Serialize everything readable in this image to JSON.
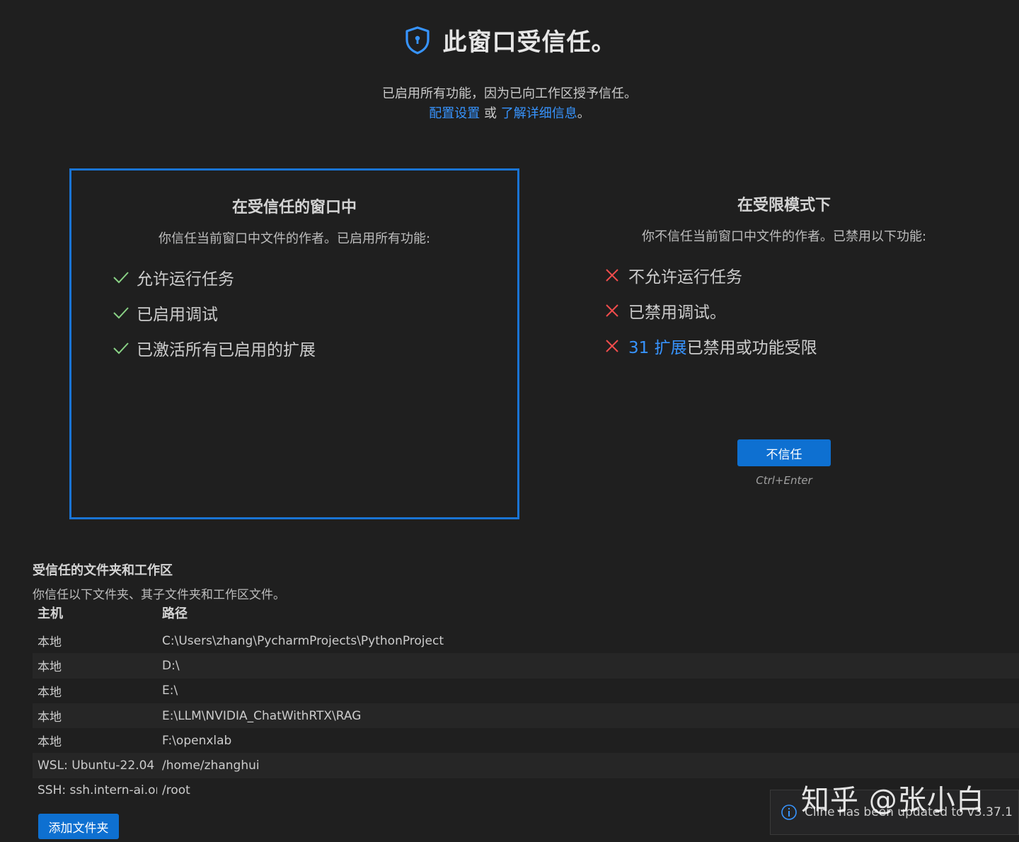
{
  "header": {
    "title": "此窗口受信任。",
    "subtitle": "已启用所有功能，因为已向工作区授予信任。",
    "link_configure": "配置设置",
    "link_or": "或",
    "link_learn": "了解详细信息",
    "link_end": "。"
  },
  "trusted_panel": {
    "title": "在受信任的窗口中",
    "description": "你信任当前窗口中文件的作者。已启用所有功能:",
    "features": [
      "允许运行任务",
      "已启用调试",
      "已激活所有已启用的扩展"
    ]
  },
  "restricted_panel": {
    "title": "在受限模式下",
    "description": "你不信任当前窗口中文件的作者。已禁用以下功能:",
    "features": [
      "不允许运行任务",
      "已禁用调试。"
    ],
    "extensions_link": "31 扩展",
    "extensions_text": "已禁用或功能受限",
    "dont_trust_button": "不信任",
    "shortcut": "Ctrl+Enter"
  },
  "trusted_folders": {
    "title": "受信任的文件夹和工作区",
    "description": "你信任以下文件夹、其子文件夹和工作区文件。",
    "columns": {
      "host": "主机",
      "path": "路径"
    },
    "rows": [
      {
        "host": "本地",
        "path": "C:\\Users\\zhang\\PycharmProjects\\PythonProject"
      },
      {
        "host": "本地",
        "path": "D:\\"
      },
      {
        "host": "本地",
        "path": "E:\\"
      },
      {
        "host": "本地",
        "path": "E:\\LLM\\NVIDIA_ChatWithRTX\\RAG"
      },
      {
        "host": "本地",
        "path": "F:\\openxlab"
      },
      {
        "host": "WSL: Ubuntu-22.04",
        "path": "/home/zhanghui"
      },
      {
        "host": "SSH: ssh.intern-ai.or",
        "path": "/root"
      }
    ],
    "add_button": "添加文件夹"
  },
  "toast": {
    "icon": "info-icon",
    "message": "Cline has been updated to v3.37.1"
  },
  "watermark": "知乎 @张小白",
  "colors": {
    "background": "#1f1f1f",
    "accent": "#0e70d1",
    "link": "#3794ff",
    "panel_border": "#1a74d4",
    "check": "#89d185",
    "cross": "#f14c4c"
  }
}
